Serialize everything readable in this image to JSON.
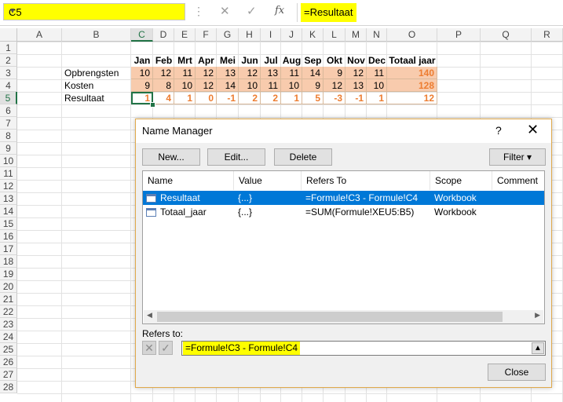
{
  "formula_bar": {
    "name_box": "C5",
    "formula": "=Resultaat"
  },
  "grid": {
    "columns": [
      "A",
      "B",
      "C",
      "D",
      "E",
      "F",
      "G",
      "H",
      "I",
      "J",
      "K",
      "L",
      "M",
      "N",
      "O",
      "P",
      "Q",
      "R"
    ],
    "rows": [
      "1",
      "2",
      "3",
      "4",
      "5",
      "6",
      "7",
      "8",
      "9",
      "10",
      "11",
      "12",
      "13",
      "14",
      "15",
      "16",
      "17",
      "18",
      "19",
      "20",
      "21",
      "22",
      "23",
      "24",
      "25",
      "26",
      "27",
      "28"
    ],
    "months": [
      "Jan",
      "Feb",
      "Mrt",
      "Apr",
      "Mei",
      "Jun",
      "Jul",
      "Aug",
      "Sep",
      "Okt",
      "Nov",
      "Dec"
    ],
    "total_header": "Totaal jaar",
    "row_labels": [
      "Opbrengsten",
      "Kosten",
      "Resultaat"
    ],
    "opbrengsten": [
      "10",
      "12",
      "11",
      "12",
      "13",
      "12",
      "13",
      "11",
      "14",
      "9",
      "12",
      "11"
    ],
    "kosten": [
      "9",
      "8",
      "10",
      "12",
      "14",
      "10",
      "11",
      "10",
      "9",
      "12",
      "13",
      "10"
    ],
    "resultaat": [
      "1",
      "4",
      "1",
      "0",
      "-1",
      "2",
      "2",
      "1",
      "5",
      "-3",
      "-1",
      "1"
    ],
    "totals": [
      "140",
      "128",
      "12"
    ]
  },
  "dialog": {
    "title": "Name Manager",
    "help": "?",
    "close": "✕",
    "buttons": {
      "new": "New...",
      "edit": "Edit...",
      "delete": "Delete",
      "filter": "Filter ▾",
      "close": "Close"
    },
    "columns": [
      "Name",
      "Value",
      "Refers To",
      "Scope",
      "Comment"
    ],
    "names": [
      {
        "name": "Resultaat",
        "value": "{...}",
        "refers_to": "=Formule!C3 - Formule!C4",
        "scope": "Workbook"
      },
      {
        "name": "Totaal_jaar",
        "value": "{...}",
        "refers_to": "=SUM(Formule!XEU5:B5)",
        "scope": "Workbook"
      }
    ],
    "refers_to_label": "Refers to:",
    "refers_to_value": "=Formule!C3 - Formule!C4"
  },
  "colors": {
    "highlight": "#ffff00",
    "fill": "#f8cbad",
    "result_text": "#ed7d31",
    "selection": "#0078d7",
    "excel_green": "#217346"
  }
}
